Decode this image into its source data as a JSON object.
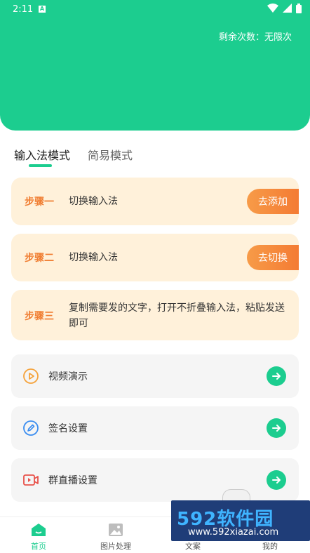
{
  "status_bar": {
    "time": "2:11",
    "notif_letter": "A"
  },
  "header": {
    "remaining_text": "剩余次数：无限次"
  },
  "tabs": [
    {
      "label": "输入法模式",
      "active": true
    },
    {
      "label": "简易模式",
      "active": false
    }
  ],
  "steps": [
    {
      "label": "步骤一",
      "text": "切换输入法",
      "button": "去添加"
    },
    {
      "label": "步骤二",
      "text": "切换输入法",
      "button": "去切换"
    },
    {
      "label": "步骤三",
      "text": "复制需要发的文字，打开不折叠输入法，粘贴发送即可"
    }
  ],
  "features": [
    {
      "label": "视频演示",
      "icon": "play-circle-icon"
    },
    {
      "label": "签名设置",
      "icon": "pen-icon"
    },
    {
      "label": "群直播设置",
      "icon": "live-video-icon"
    }
  ],
  "bottom_nav": [
    {
      "label": "首页",
      "icon": "home-icon",
      "active": true
    },
    {
      "label": "图片处理",
      "icon": "image-icon",
      "active": false
    },
    {
      "label": "文案",
      "icon": "document-icon",
      "active": false
    },
    {
      "label": "我的",
      "icon": "profile-icon",
      "active": false
    }
  ],
  "watermark": {
    "title": "592软件园",
    "site": "www.592xiazai.com"
  },
  "colors": {
    "accent": "#1ccd8f",
    "step_bg": "#fff1da",
    "step_label": "#f07d31",
    "button": "#f47b33"
  }
}
